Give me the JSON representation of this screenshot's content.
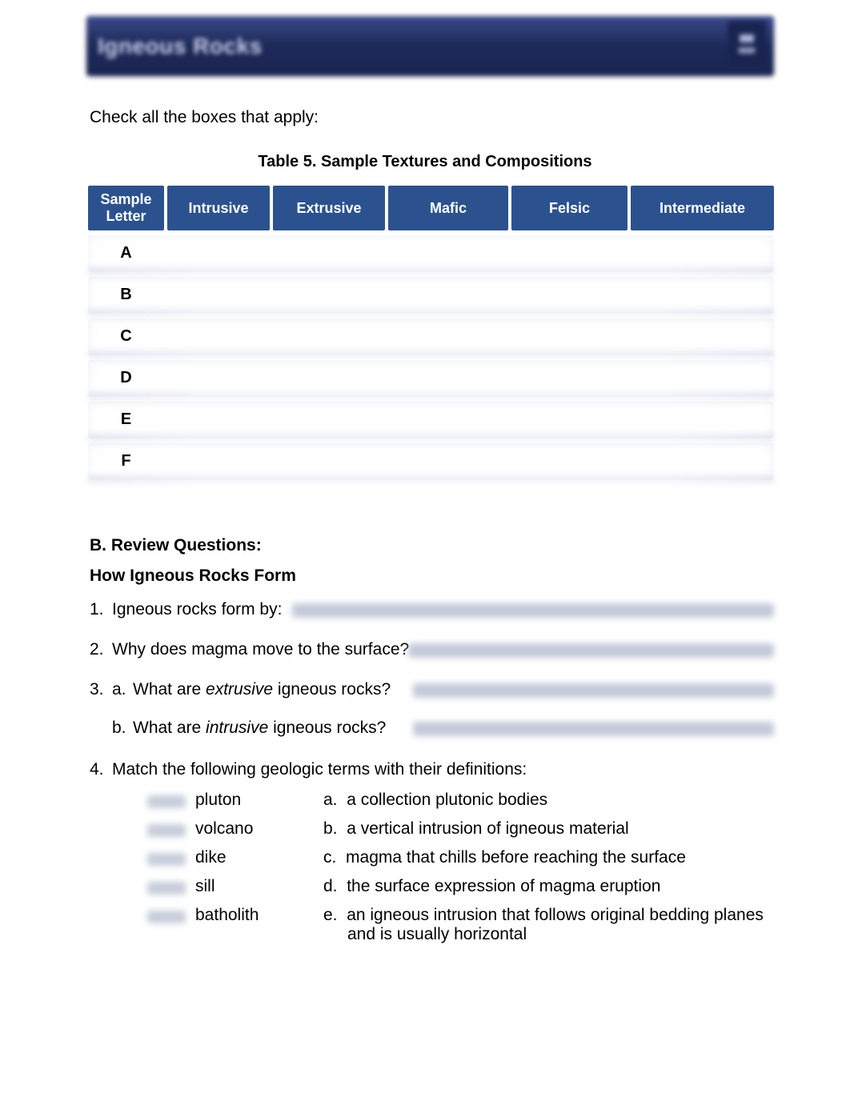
{
  "header": {
    "title": "Igneous Rocks"
  },
  "instruction": "Check all the boxes that apply:",
  "table": {
    "title": "Table 5. Sample Textures and Compositions",
    "headers": {
      "sample_letter_line1": "Sample",
      "sample_letter_line2": "Letter",
      "intrusive": "Intrusive",
      "extrusive": "Extrusive",
      "mafic": "Mafic",
      "felsic": "Felsic",
      "intermediate": "Intermediate"
    },
    "rows": [
      "A",
      "B",
      "C",
      "D",
      "E",
      "F"
    ]
  },
  "sectionB": {
    "heading": "B. Review Questions:",
    "subheading": "How Igneous Rocks Form",
    "q1_num": "1.",
    "q1_text": "Igneous rocks form by:",
    "q2_num": "2.",
    "q2_text": "Why does magma move to the surface?",
    "q3_num": "3.",
    "q3a_letter": "a.",
    "q3a_prefix": "What are ",
    "q3a_italic": "extrusive",
    "q3a_suffix": "  igneous rocks?",
    "q3b_letter": "b.",
    "q3b_prefix": "What are ",
    "q3b_italic": "intrusive",
    "q3b_suffix": "  igneous rocks?",
    "q4_num": "4.",
    "q4_text": "Match the following geologic terms with their definitions:",
    "match": [
      {
        "term": "pluton",
        "def_letter": "a.",
        "def": "a collection  plutonic bodies"
      },
      {
        "term": "volcano",
        "def_letter": "b.",
        "def": "a vertical intrusion of igneous material"
      },
      {
        "term": "dike",
        "def_letter": "c.",
        "def": "magma that chills before reaching the surface"
      },
      {
        "term": "sill",
        "def_letter": "d.",
        "def": "the surface expression of magma eruption"
      },
      {
        "term": "batholith",
        "def_letter": "e.",
        "def": "an igneous intrusion that follows original bedding planes and is usually  horizontal"
      }
    ]
  }
}
